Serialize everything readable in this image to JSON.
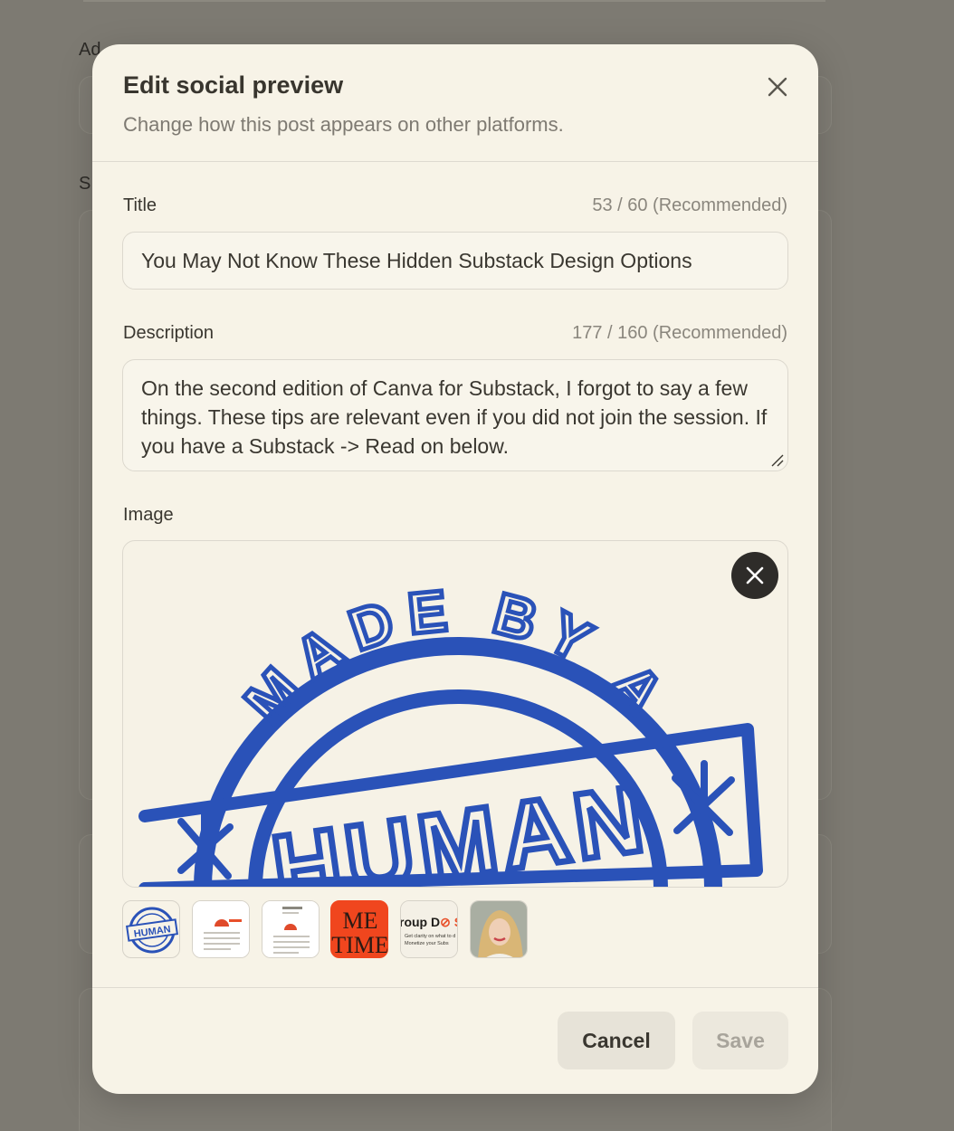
{
  "background": {
    "labels": [
      "Ad",
      "S"
    ]
  },
  "modal": {
    "title": "Edit social preview",
    "subtitle": "Change how this post appears on other platforms."
  },
  "title_field": {
    "label": "Title",
    "count": "53 / 60 (Recommended)",
    "value": "You May Not Know These Hidden Substack Design Options"
  },
  "description_field": {
    "label": "Description",
    "count": "177 / 160 (Recommended)",
    "value": "On the second edition of Canva for Substack, I forgot to say a few things. These tips are relevant even if you did not join the session. If you have a Substack -> Read on below."
  },
  "image_field": {
    "label": "Image",
    "stamp_text": {
      "top": "MADE BY A",
      "center": "HUMAN"
    },
    "thumbnails": [
      {
        "name": "thumb-made-by-human",
        "text": "HUMAN"
      },
      {
        "name": "thumb-screenshot-1",
        "text": ""
      },
      {
        "name": "thumb-screenshot-2",
        "text": ""
      },
      {
        "name": "thumb-me-time",
        "text_top": "ME",
        "text_bottom": "TIME"
      },
      {
        "name": "thumb-group-do",
        "text_main": "roup D",
        "text_accent": "⊘ S",
        "text_line1": "Get clarity on what to d",
        "text_line2": "Monetize your Subs"
      },
      {
        "name": "thumb-portrait",
        "text": ""
      }
    ]
  },
  "footer": {
    "cancel_label": "Cancel",
    "save_label": "Save"
  },
  "colors": {
    "stamp_blue": "#2a52b8",
    "me_time_red": "#f0461e",
    "accent_orange": "#e8502a"
  }
}
